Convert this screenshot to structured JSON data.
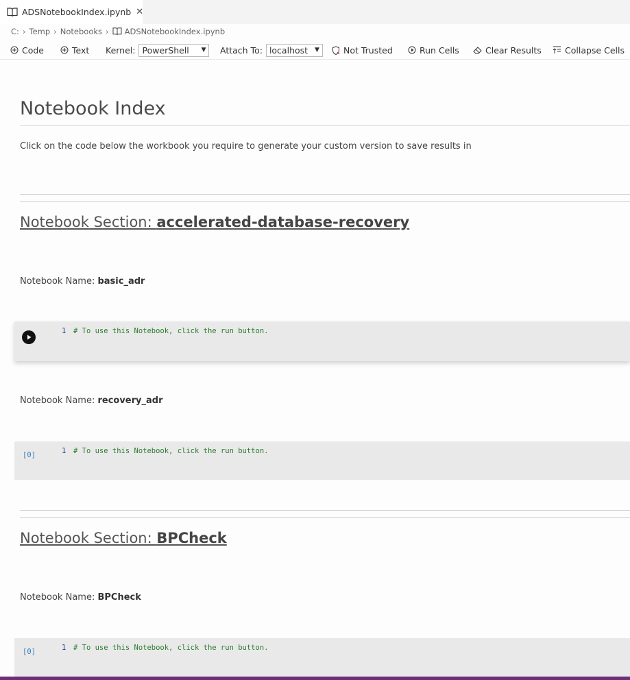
{
  "tab": {
    "title": "ADSNotebookIndex.ipynb",
    "close": "✕"
  },
  "breadcrumb": [
    "C:",
    "Temp",
    "Notebooks",
    "ADSNotebookIndex.ipynb"
  ],
  "toolbar": {
    "code_label": "Code",
    "text_label": "Text",
    "kernel_label": "Kernel:",
    "kernel_value": "PowerShell",
    "attach_label": "Attach To:",
    "attach_value": "localhost",
    "trust_label": "Not Trusted",
    "run_label": "Run Cells",
    "clear_label": "Clear Results",
    "collapse_label": "Collapse Cells"
  },
  "page": {
    "title": "Notebook Index",
    "intro": "Click on the code below the workbook you require to generate your custom version to save results in"
  },
  "sections": [
    {
      "prefix": "Notebook Section: ",
      "name": "accelerated-database-recovery"
    },
    {
      "prefix": "Notebook Section: ",
      "name": "BPCheck"
    }
  ],
  "notebooks": [
    {
      "label": "Notebook Name: ",
      "name": "basic_adr"
    },
    {
      "label": "Notebook Name: ",
      "name": "recovery_adr"
    },
    {
      "label": "Notebook Name: ",
      "name": "BPCheck"
    }
  ],
  "cells": [
    {
      "count": "",
      "line": "1",
      "code": "# To use this Notebook, click the run button."
    },
    {
      "count": "[0]",
      "line": "1",
      "code": "# To use this Notebook, click the run button."
    },
    {
      "count": "[0]",
      "line": "1",
      "code": "# To use this Notebook, click the run button."
    }
  ]
}
